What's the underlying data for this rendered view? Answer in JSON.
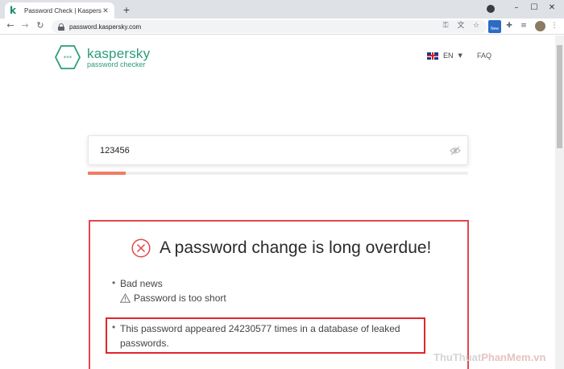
{
  "browser": {
    "tab_title": "Password Check | Kaspersky",
    "url": "password.kaspersky.com",
    "extension_badge": "New"
  },
  "header": {
    "brand": "kaspersky",
    "product": "password checker",
    "language": "EN",
    "faq": "FAQ"
  },
  "checker": {
    "password_value": "123456",
    "strength_level": 0.1
  },
  "result": {
    "headline": "A password change is long overdue!",
    "bad_news_label": "Bad news",
    "warning": "Password is too short",
    "leak_message": "This password appeared 24230577 times in a database of leaked passwords."
  },
  "watermark": {
    "part1": "ThuThuat",
    "part2": "PhanMem.vn"
  },
  "colors": {
    "brand_green": "#2a9d7c",
    "alert_red": "#e0474c",
    "strength_fill": "#ef7d64"
  }
}
